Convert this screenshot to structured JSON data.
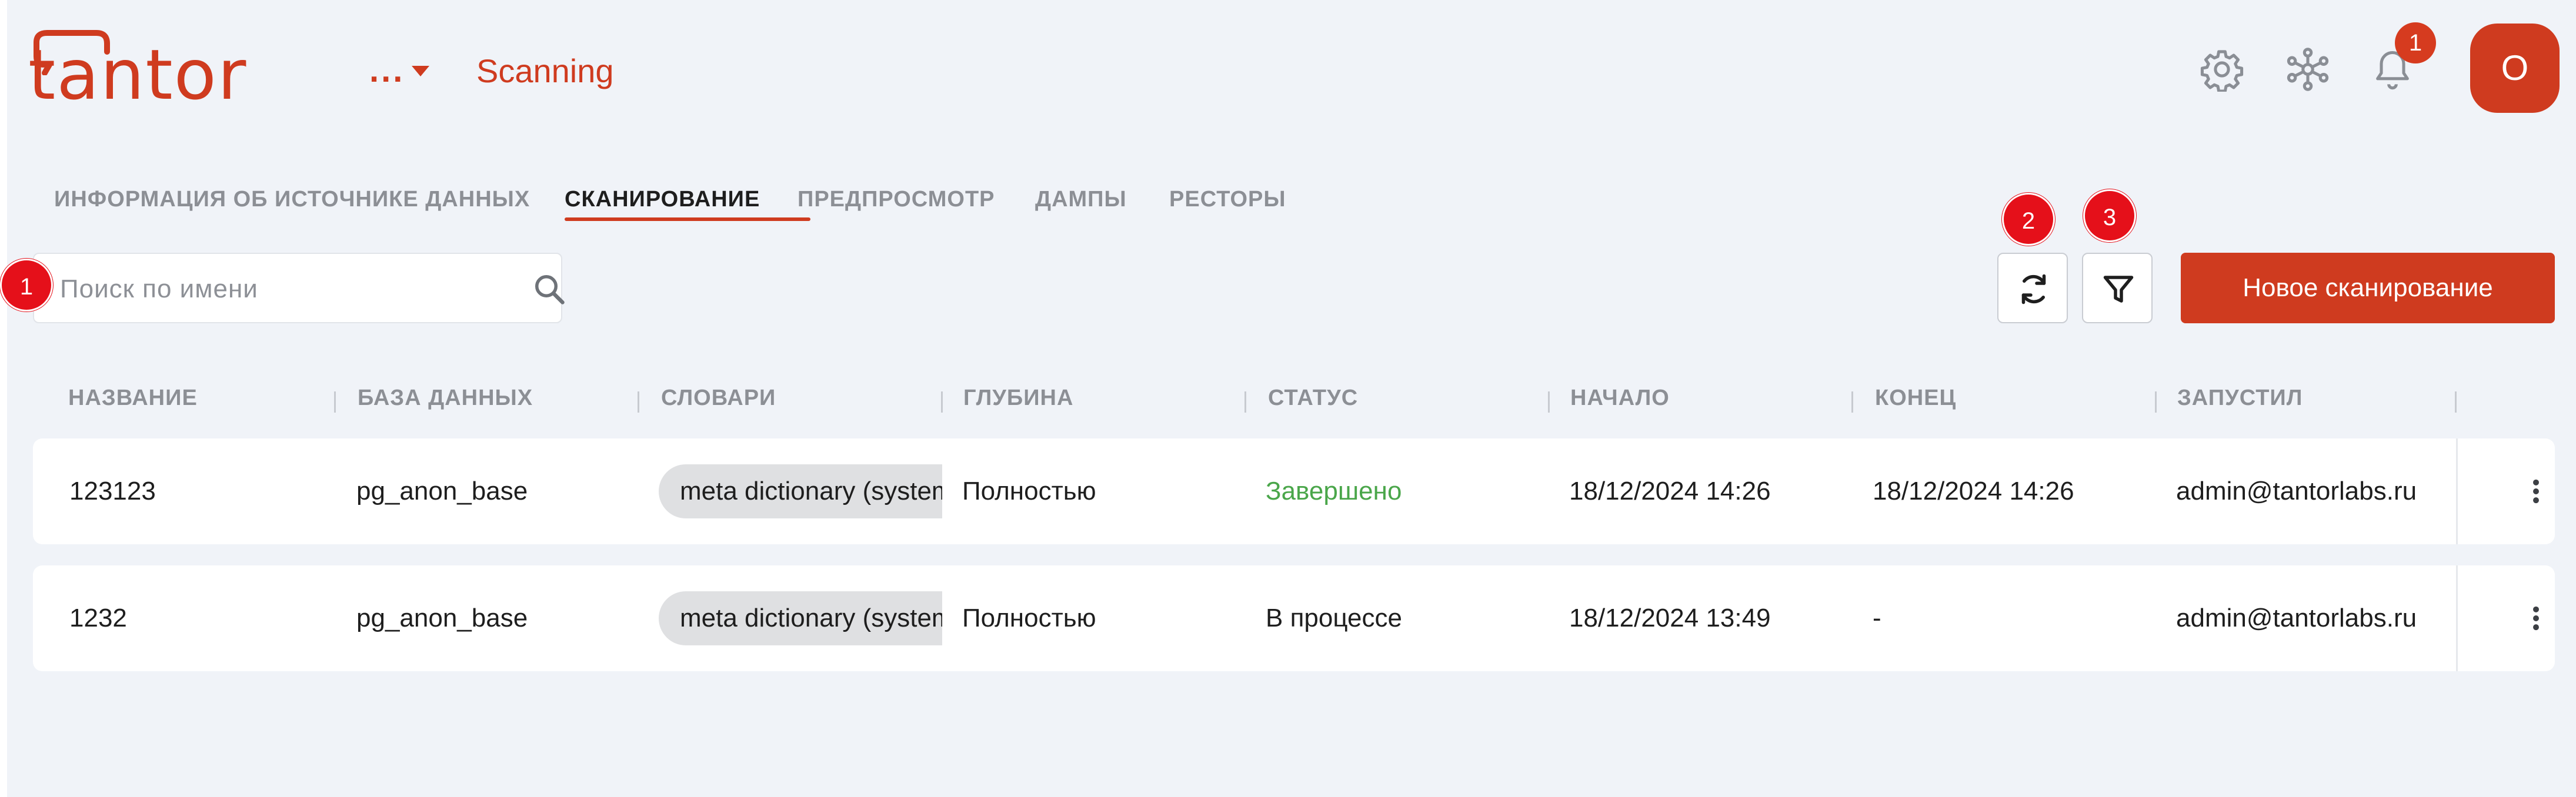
{
  "header": {
    "logo_text": "tantor",
    "breadcrumb_more": "...",
    "breadcrumb_current": "Scanning",
    "notifications_count": "1",
    "avatar_initial": "O"
  },
  "tabs": [
    {
      "label": "ИНФОРМАЦИЯ ОБ ИСТОЧНИКЕ ДАННЫХ"
    },
    {
      "label": "СКАНИРОВАНИЕ"
    },
    {
      "label": "ПРЕДПРОСМОТР"
    },
    {
      "label": "ДАМПЫ"
    },
    {
      "label": "РЕСТОРЫ"
    }
  ],
  "active_tab": "СКАНИРОВАНИЕ",
  "toolbar": {
    "search_placeholder": "Поиск по имени",
    "new_scan_label": "Новое сканирование"
  },
  "step_badges": [
    "1",
    "2",
    "3"
  ],
  "table": {
    "columns": [
      "НАЗВАНИЕ",
      "БАЗА ДАННЫХ",
      "СЛОВАРИ",
      "ГЛУБИНА",
      "СТАТУС",
      "НАЧАЛО",
      "КОНЕЦ",
      "ЗАПУСТИЛ"
    ],
    "rows": [
      {
        "name": "123123",
        "database": "pg_anon_base",
        "dictionary": "meta dictionary (system)",
        "depth": "Полностью",
        "status": "Завершено",
        "start": "18/12/2024 14:26",
        "end": "18/12/2024 14:26",
        "started_by": "admin@tantorlabs.ru"
      },
      {
        "name": "1232",
        "database": "pg_anon_base",
        "dictionary": "meta dictionary (system)",
        "depth": "Полностью",
        "status": "В процессе",
        "start": "18/12/2024 13:49",
        "end": "-",
        "started_by": "admin@tantorlabs.ru"
      }
    ]
  },
  "colors": {
    "brand": "#cf3b1f",
    "status_done": "#4aa64a",
    "step_badge": "#e5101a",
    "background": "#f0f3f8"
  },
  "icons": {
    "settings": "gear-icon",
    "cluster": "network-icon",
    "notifications": "bell-icon",
    "search": "search-icon",
    "refresh": "refresh-icon",
    "filter": "filter-icon",
    "row_menu": "kebab-menu-icon"
  }
}
